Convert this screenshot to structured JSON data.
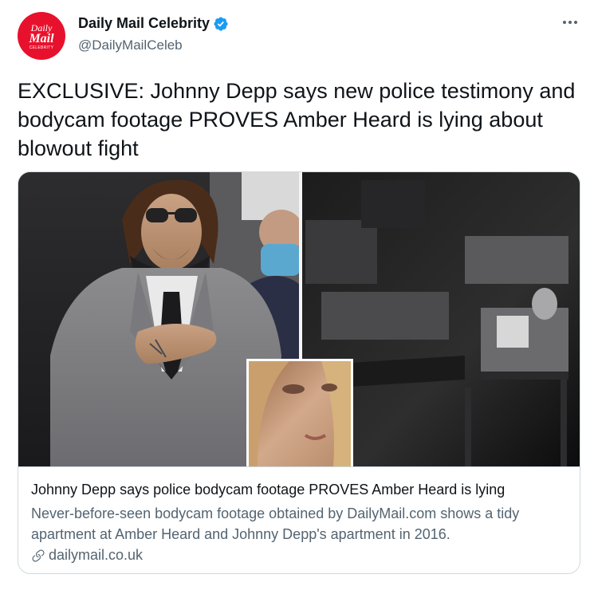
{
  "account": {
    "avatar_lines": [
      "Daily",
      "Mail",
      "CELEBRITY"
    ],
    "display_name": "Daily Mail Celebrity",
    "handle": "@DailyMailCeleb",
    "verified_icon": "verified-badge-icon",
    "more_icon": "more-dots-icon"
  },
  "tweet": {
    "text": "EXCLUSIVE: Johnny Depp says new police testimony and bodycam footage PROVES Amber Heard is lying about blowout fight"
  },
  "card": {
    "title": "Johnny Depp says police bodycam footage PROVES Amber Heard is lying",
    "description": "Never-before-seen bodycam footage obtained by DailyMail.com shows a tidy apartment at Amber Heard and Johnny Depp's apartment in 2016.",
    "domain": "dailymail.co.uk",
    "link_icon": "link-icon"
  },
  "colors": {
    "brand_red": "#e8112d",
    "verified_blue": "#1d9bf0",
    "secondary_text": "#536471",
    "border": "#cfd9de"
  }
}
